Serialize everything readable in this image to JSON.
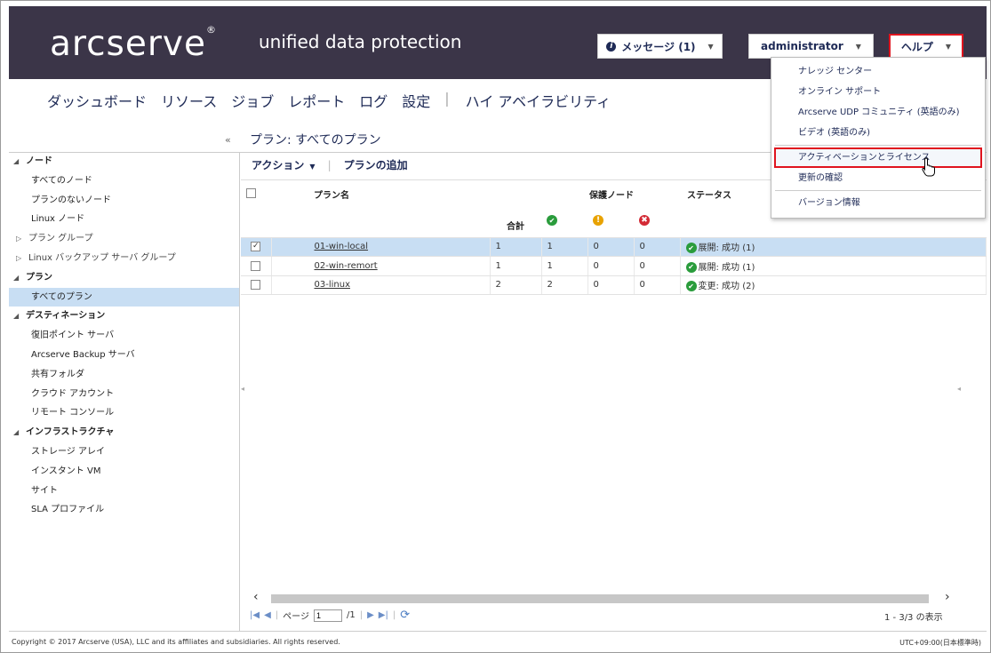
{
  "header": {
    "logo": "arcserve",
    "logo_mark": "®",
    "product": "unified data protection",
    "messages_label": "メッセージ (1)",
    "user_label": "administrator",
    "help_label": "ヘルプ"
  },
  "nav": {
    "items": [
      "ダッシュボード",
      "リソース",
      "ジョブ",
      "レポート",
      "ログ",
      "設定",
      "ハイ アベイラビリティ"
    ],
    "separator": "|"
  },
  "page_title": "プラン: すべてのプラン",
  "sidebar": {
    "items": [
      {
        "label": "ノード"
      },
      {
        "label": "すべてのノード"
      },
      {
        "label": "プランのないノード"
      },
      {
        "label": "Linux ノード"
      },
      {
        "label": "プラン グループ"
      },
      {
        "label": "Linux バックアップ サーバ グループ"
      },
      {
        "label": "プラン"
      },
      {
        "label": "すべてのプラン"
      },
      {
        "label": "デスティネーション"
      },
      {
        "label": "復旧ポイント サーバ"
      },
      {
        "label": "Arcserve Backup サーバ"
      },
      {
        "label": "共有フォルダ"
      },
      {
        "label": "クラウド アカウント"
      },
      {
        "label": "リモート コンソール"
      },
      {
        "label": "インフラストラクチャ"
      },
      {
        "label": "ストレージ アレイ"
      },
      {
        "label": "インスタント VM"
      },
      {
        "label": "サイト"
      },
      {
        "label": "SLA プロファイル"
      }
    ]
  },
  "toolbar": {
    "action_label": "アクション",
    "add_plan_label": "プランの追加"
  },
  "table": {
    "col_plan_name": "プラン名",
    "col_protected_nodes": "保護ノード",
    "col_status": "ステータス",
    "col_total": "合計",
    "rows": [
      {
        "name": "01-win-local",
        "total": "1",
        "ok": "1",
        "warn": "0",
        "err": "0",
        "status": "展開: 成功 (1)",
        "checked": "✓"
      },
      {
        "name": "02-win-remort",
        "total": "1",
        "ok": "1",
        "warn": "0",
        "err": "0",
        "status": "展開: 成功 (1)",
        "checked": ""
      },
      {
        "name": "03-linux",
        "total": "2",
        "ok": "2",
        "warn": "0",
        "err": "0",
        "status": "変更: 成功 (2)",
        "checked": ""
      }
    ]
  },
  "pager": {
    "page_label": "ページ",
    "page_value": "1",
    "page_total": "/1",
    "range": "1 - 3/3 の表示"
  },
  "footer": {
    "copyright": "Copyright © 2017 Arcserve (USA), LLC and its affiliates and subsidiaries. All rights reserved.",
    "timezone": "UTC+09:00(日本標準時)"
  },
  "help_menu": {
    "items": [
      "ナレッジ センター",
      "オンライン サポート",
      "Arcserve UDP コミュニティ (英語のみ)",
      "ビデオ (英語のみ)",
      "アクティベーションとライセンス",
      "更新の確認",
      "バージョン情報"
    ]
  },
  "colors": {
    "header_bg": "#3b3548",
    "brand_text": "#1e2a56",
    "selection": "#c8def3",
    "highlight_box": "#e0141e",
    "ok": "#2a9c3c",
    "warn": "#e8a200",
    "error": "#d32a35"
  }
}
